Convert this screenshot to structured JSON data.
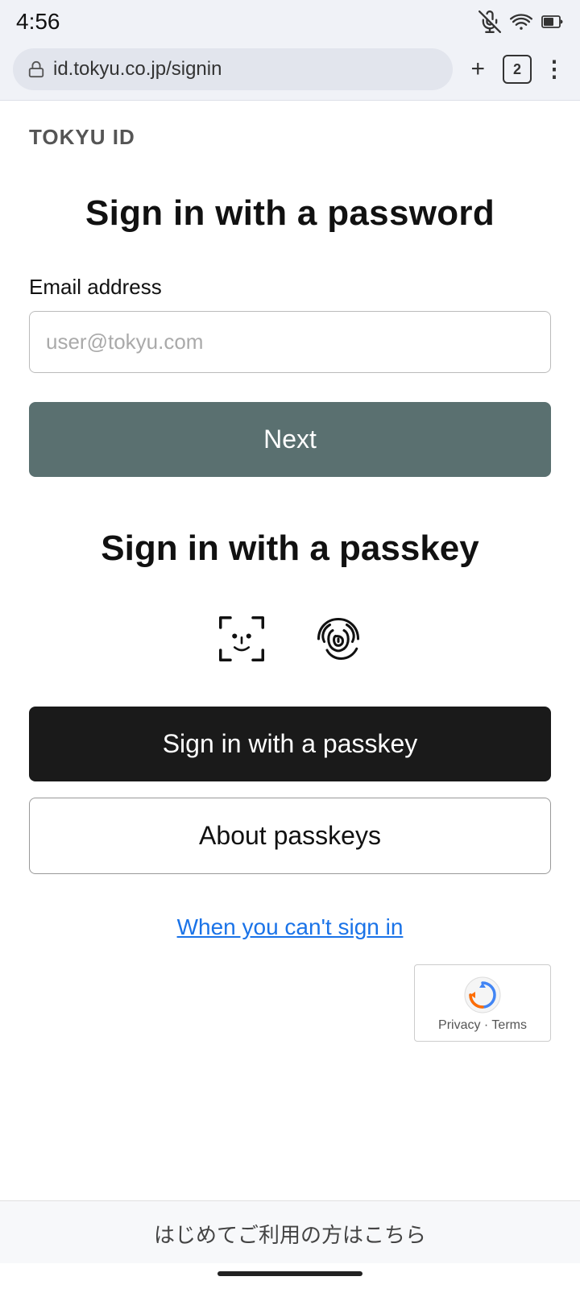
{
  "statusBar": {
    "time": "4:56",
    "muteIcon": "🔇",
    "wifiIcon": "wifi",
    "batteryIcon": "battery"
  },
  "browserBar": {
    "url": "id.tokyu.co.jp/signin",
    "addTabLabel": "+",
    "tabCount": "2",
    "moreMenuLabel": "⋮"
  },
  "brand": {
    "title": "TOKYU ID"
  },
  "passwordSection": {
    "pageTitle": "Sign in with a password",
    "emailLabel": "Email address",
    "emailPlaceholder": "user@tokyu.com",
    "nextButtonLabel": "Next"
  },
  "passkeySection": {
    "title": "Sign in with a passkey",
    "signInButtonLabel": "Sign in with a passkey",
    "aboutButtonLabel": "About passkeys"
  },
  "cantSignIn": {
    "linkText": "When you can't sign in"
  },
  "recaptcha": {
    "privacyTerms": "Privacy · Terms"
  },
  "bottomBar": {
    "text": "はじめてご利用の方はこちら"
  }
}
